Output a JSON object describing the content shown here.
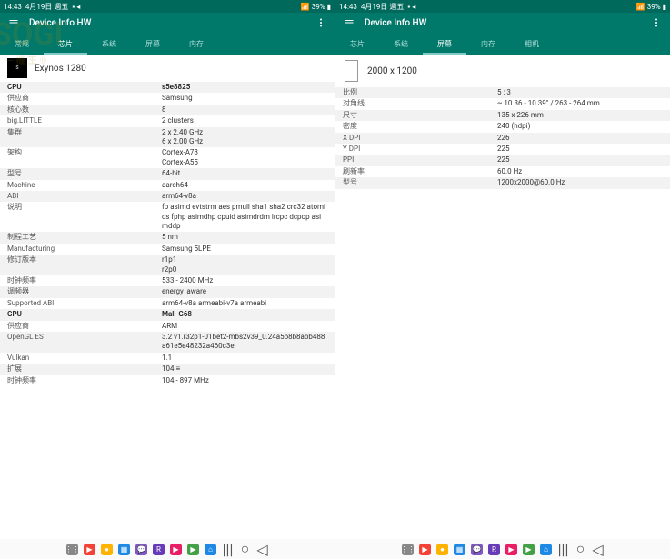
{
  "status": {
    "time": "14:43",
    "date": "4月19日 週五",
    "battery": "39%"
  },
  "app_title": "Device Info HW",
  "left": {
    "tabs": [
      "常规",
      "芯片",
      "系统",
      "屏幕",
      "内存"
    ],
    "active_tab": 1,
    "chip_name": "Exynos 1280",
    "rows": [
      {
        "label": "CPU",
        "value": "s5e8825",
        "bold": true
      },
      {
        "label": "供应商",
        "value": "Samsung"
      },
      {
        "label": "核心数",
        "value": "8"
      },
      {
        "label": "big.LITTLE",
        "value": "2 clusters"
      },
      {
        "label": "集群",
        "value": "2 x 2.40 GHz\n6 x 2.00 GHz"
      },
      {
        "label": "架构",
        "value": "Cortex-A78\nCortex-A55"
      },
      {
        "label": "型号",
        "value": "64-bit"
      },
      {
        "label": "Machine",
        "value": "aarch64"
      },
      {
        "label": "ABI",
        "value": "arm64-v8a"
      },
      {
        "label": "说明",
        "value": "fp asimd evtstrm aes pmull sha1 sha2 crc32 atomics fphp asimdhp cpuid asimdrdm lrcpc dcpop asimddp"
      },
      {
        "label": "制程工艺",
        "value": "5 nm"
      },
      {
        "label": "Manufacturing",
        "value": "Samsung 5LPE"
      },
      {
        "label": "修订版本",
        "value": "r1p1\nr2p0"
      },
      {
        "label": "时钟频率",
        "value": "533 - 2400 MHz"
      },
      {
        "label": "调频器",
        "value": "energy_aware"
      },
      {
        "label": "Supported ABI",
        "value": "arm64-v8a armeabi-v7a armeabi"
      },
      {
        "label": "GPU",
        "value": "Mali-G68",
        "bold": true
      },
      {
        "label": "供应商",
        "value": "ARM"
      },
      {
        "label": "OpenGL ES",
        "value": "3.2 v1.r32p1-01bet2-mbs2v39_0.24a5b8b8abb488a61e5e48232a460c3e"
      },
      {
        "label": "Vulkan",
        "value": "1.1"
      },
      {
        "label": "扩展",
        "value": "104 ≡"
      },
      {
        "label": "时钟频率",
        "value": "104 - 897 MHz"
      }
    ]
  },
  "right": {
    "tabs": [
      "芯片",
      "系统",
      "屏幕",
      "内存",
      "相机"
    ],
    "active_tab": 2,
    "screen_res": "2000 x 1200",
    "rows": [
      {
        "label": "比例",
        "value": "5 : 3"
      },
      {
        "label": "对角线",
        "value": "~ 10.36 - 10.39\" / 263 - 264 mm"
      },
      {
        "label": "尺寸",
        "value": "135 x 226 mm"
      },
      {
        "label": "密度",
        "value": "240 (hdpi)"
      },
      {
        "label": "X DPI",
        "value": "226"
      },
      {
        "label": "Y DPI",
        "value": "225"
      },
      {
        "label": "PPI",
        "value": "225"
      },
      {
        "label": "刷新率",
        "value": "60.0 Hz"
      },
      {
        "label": "型号",
        "value": "1200x2000@60.0 Hz"
      }
    ]
  },
  "dock": {
    "icons": [
      {
        "name": "apps-icon",
        "color": "#888",
        "glyph": "⋮⋮"
      },
      {
        "name": "youtube-icon",
        "color": "#f44336",
        "glyph": "▶"
      },
      {
        "name": "keep-icon",
        "color": "#ffb300",
        "glyph": "●"
      },
      {
        "name": "calendar-icon",
        "color": "#1e88e5",
        "glyph": "▦"
      },
      {
        "name": "chat-icon",
        "color": "#7e57c2",
        "glyph": "💬"
      },
      {
        "name": "rakuten-icon",
        "color": "#673ab7",
        "glyph": "R"
      },
      {
        "name": "media-icon",
        "color": "#e91e63",
        "glyph": "▶"
      },
      {
        "name": "play-icon",
        "color": "#43a047",
        "glyph": "▶"
      },
      {
        "name": "home-icon",
        "color": "#1e88e5",
        "glyph": "⌂"
      }
    ]
  }
}
